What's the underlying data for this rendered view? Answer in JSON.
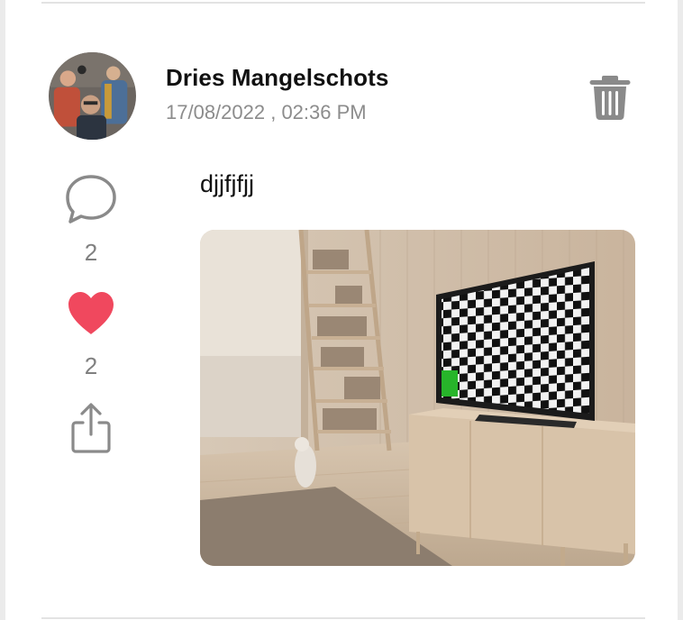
{
  "post": {
    "author": "Dries Mangelschots",
    "timestamp": "17/08/2022 , 02:36 PM",
    "text": "djjfjfjj",
    "comment_count": "2",
    "like_count": "2",
    "liked": true
  },
  "icons": {
    "avatar": "avatar-photo",
    "delete": "trash-icon",
    "comment": "comment-bubble-icon",
    "like": "heart-icon",
    "share": "share-icon"
  },
  "colors": {
    "like_active": "#f0485e",
    "icon_gray": "#8a8a8a",
    "meta_text": "#8c8c8c"
  }
}
